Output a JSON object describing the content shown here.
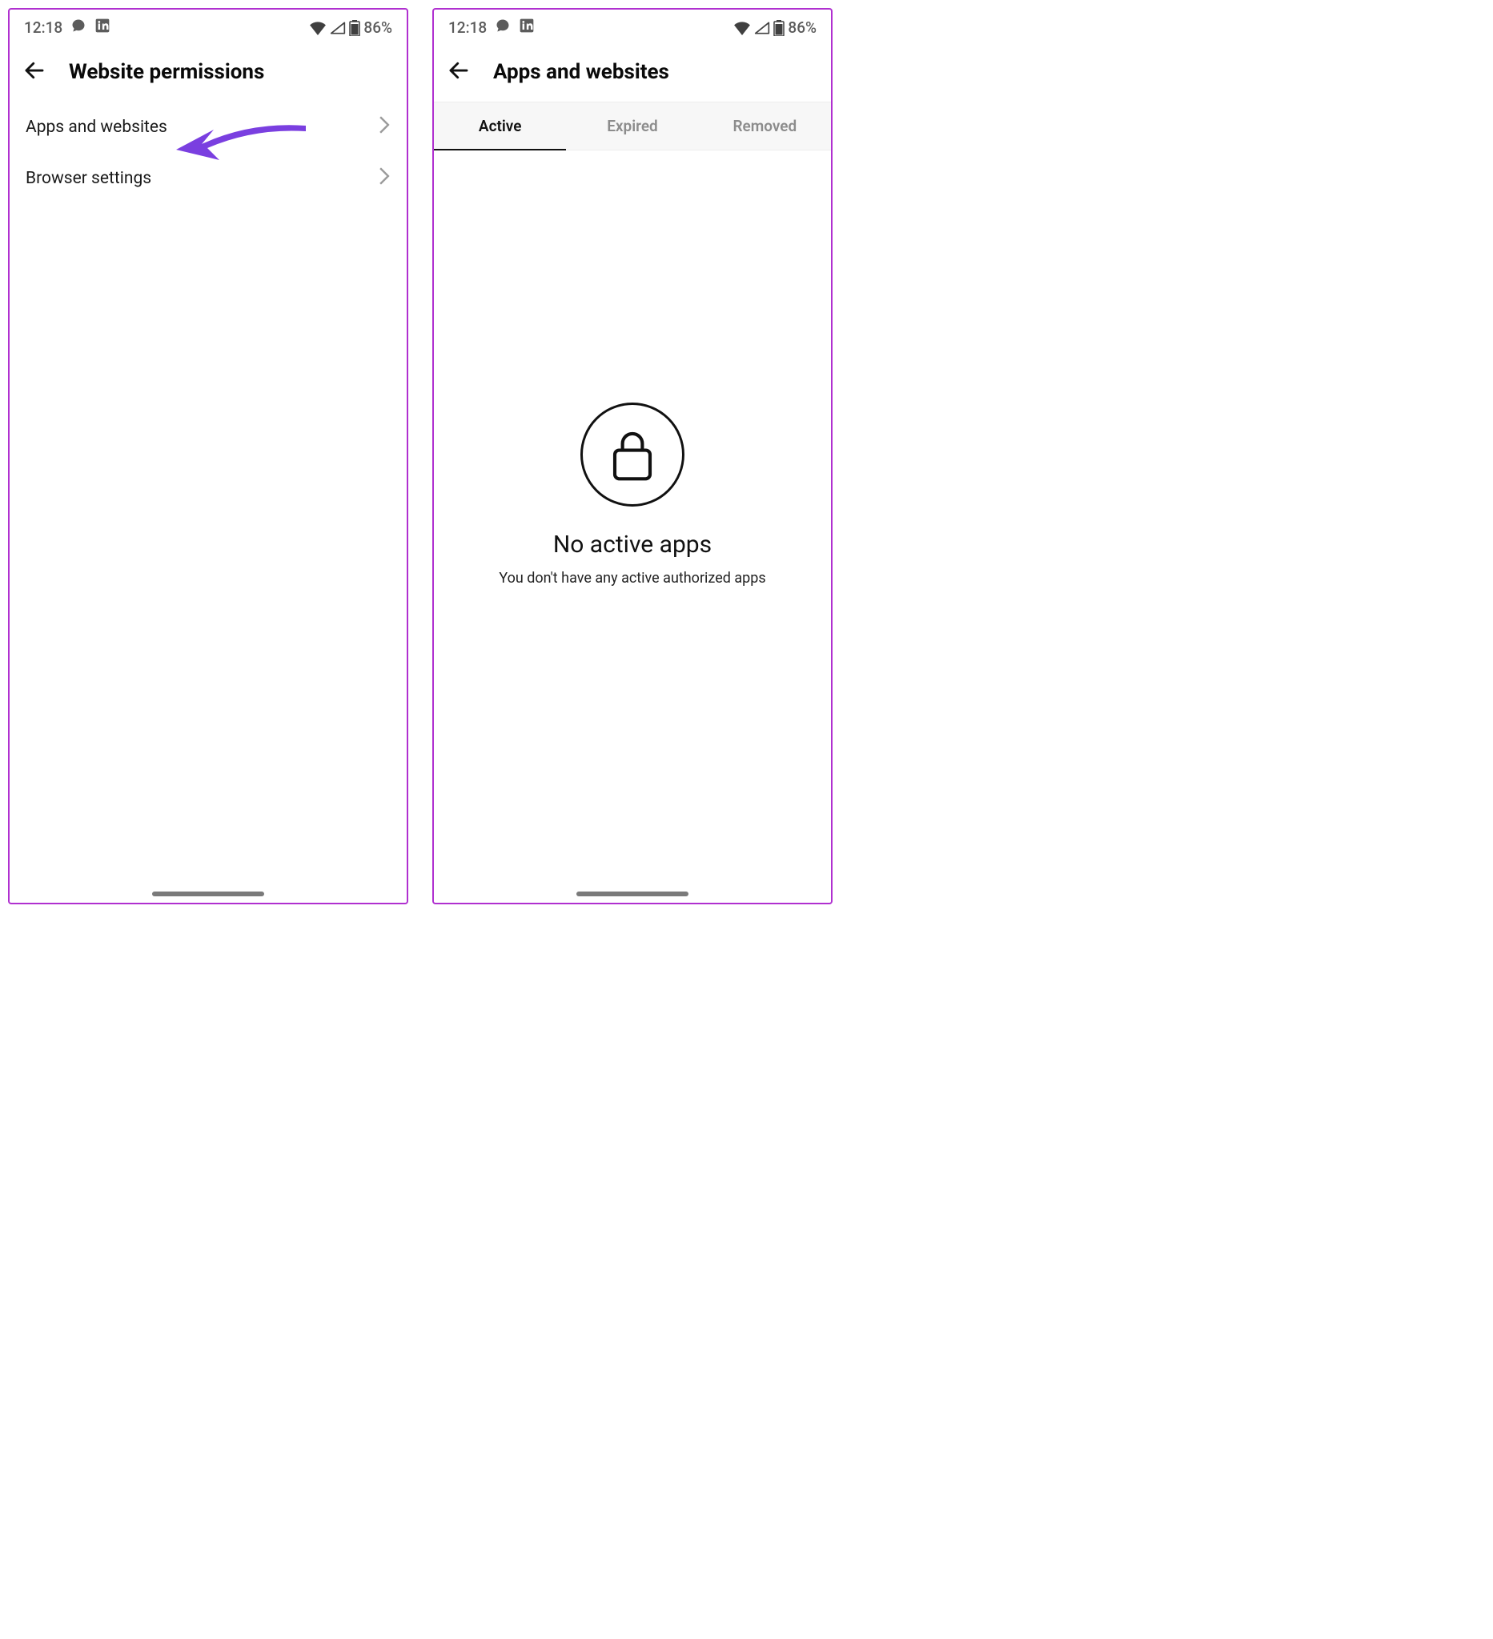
{
  "status": {
    "time": "12:18",
    "battery": "86%"
  },
  "left": {
    "title": "Website permissions",
    "items": [
      {
        "label": "Apps and websites"
      },
      {
        "label": "Browser settings"
      }
    ]
  },
  "right": {
    "title": "Apps and websites",
    "tabs": [
      {
        "label": "Active"
      },
      {
        "label": "Expired"
      },
      {
        "label": "Removed"
      }
    ],
    "empty": {
      "title": "No active apps",
      "subtitle": "You don't have any active authorized apps"
    }
  }
}
